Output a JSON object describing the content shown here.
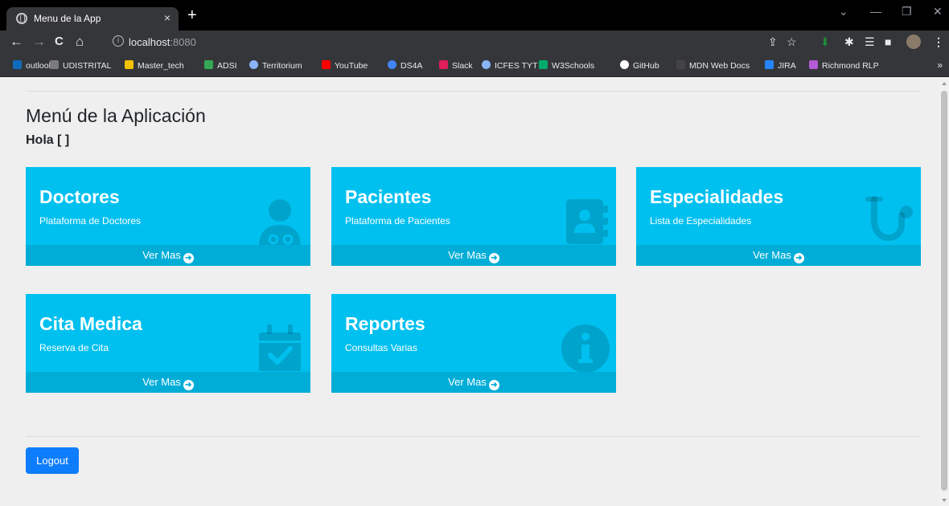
{
  "browser": {
    "tab_title": "Menu de la App",
    "tab_close": "×",
    "new_tab": "+",
    "url_host": "localhost",
    "url_port": ":8080",
    "bookmarks": [
      {
        "label": "outlook",
        "color": "#0f6cbd"
      },
      {
        "label": "UDISTRITAL",
        "color": "#7b7b7b"
      },
      {
        "label": "Master_tech",
        "color": "#f2c200"
      },
      {
        "label": "ADSI",
        "color": "#34a853"
      },
      {
        "label": "Territorium",
        "color": "#8ab4f8"
      },
      {
        "label": "YouTube",
        "color": "#ff0000"
      },
      {
        "label": "DS4A",
        "color": "#4285f4"
      },
      {
        "label": "Slack",
        "color": "#e01e5a"
      },
      {
        "label": "ICFES TYT",
        "color": "#8ab4f8"
      },
      {
        "label": "W3Schools",
        "color": "#04aa6d"
      },
      {
        "label": "GitHub",
        "color": "#ffffff"
      },
      {
        "label": "MDN Web Docs",
        "color": "#444444"
      },
      {
        "label": "JIRA",
        "color": "#2684ff"
      },
      {
        "label": "Richmond RLP",
        "color": "#b45ad6"
      }
    ],
    "more": "»"
  },
  "page": {
    "title": "Menú de la Aplicación",
    "greeting": "Hola [ ]",
    "cards": [
      {
        "title": "Doctores",
        "subtitle": "Plataforma de Doctores",
        "footer": "Ver Mas",
        "icon": "doctor-icon"
      },
      {
        "title": "Pacientes",
        "subtitle": "Plataforma de Pacientes",
        "footer": "Ver Mas",
        "icon": "address-book-icon"
      },
      {
        "title": "Especialidades",
        "subtitle": "Lista de Especialidades",
        "footer": "Ver Mas",
        "icon": "stethoscope-icon"
      },
      {
        "title": "Cita Medica",
        "subtitle": "Reserva de Cita",
        "footer": "Ver Mas",
        "icon": "calendar-check-icon"
      },
      {
        "title": "Reportes",
        "subtitle": "Consultas Varias",
        "footer": "Ver Mas",
        "icon": "info-circle-icon"
      }
    ],
    "logout_label": "Logout"
  },
  "colors": {
    "card_bg": "#00c0ef",
    "card_footer": "#00add7",
    "logout_bg": "#0d7dfb"
  }
}
